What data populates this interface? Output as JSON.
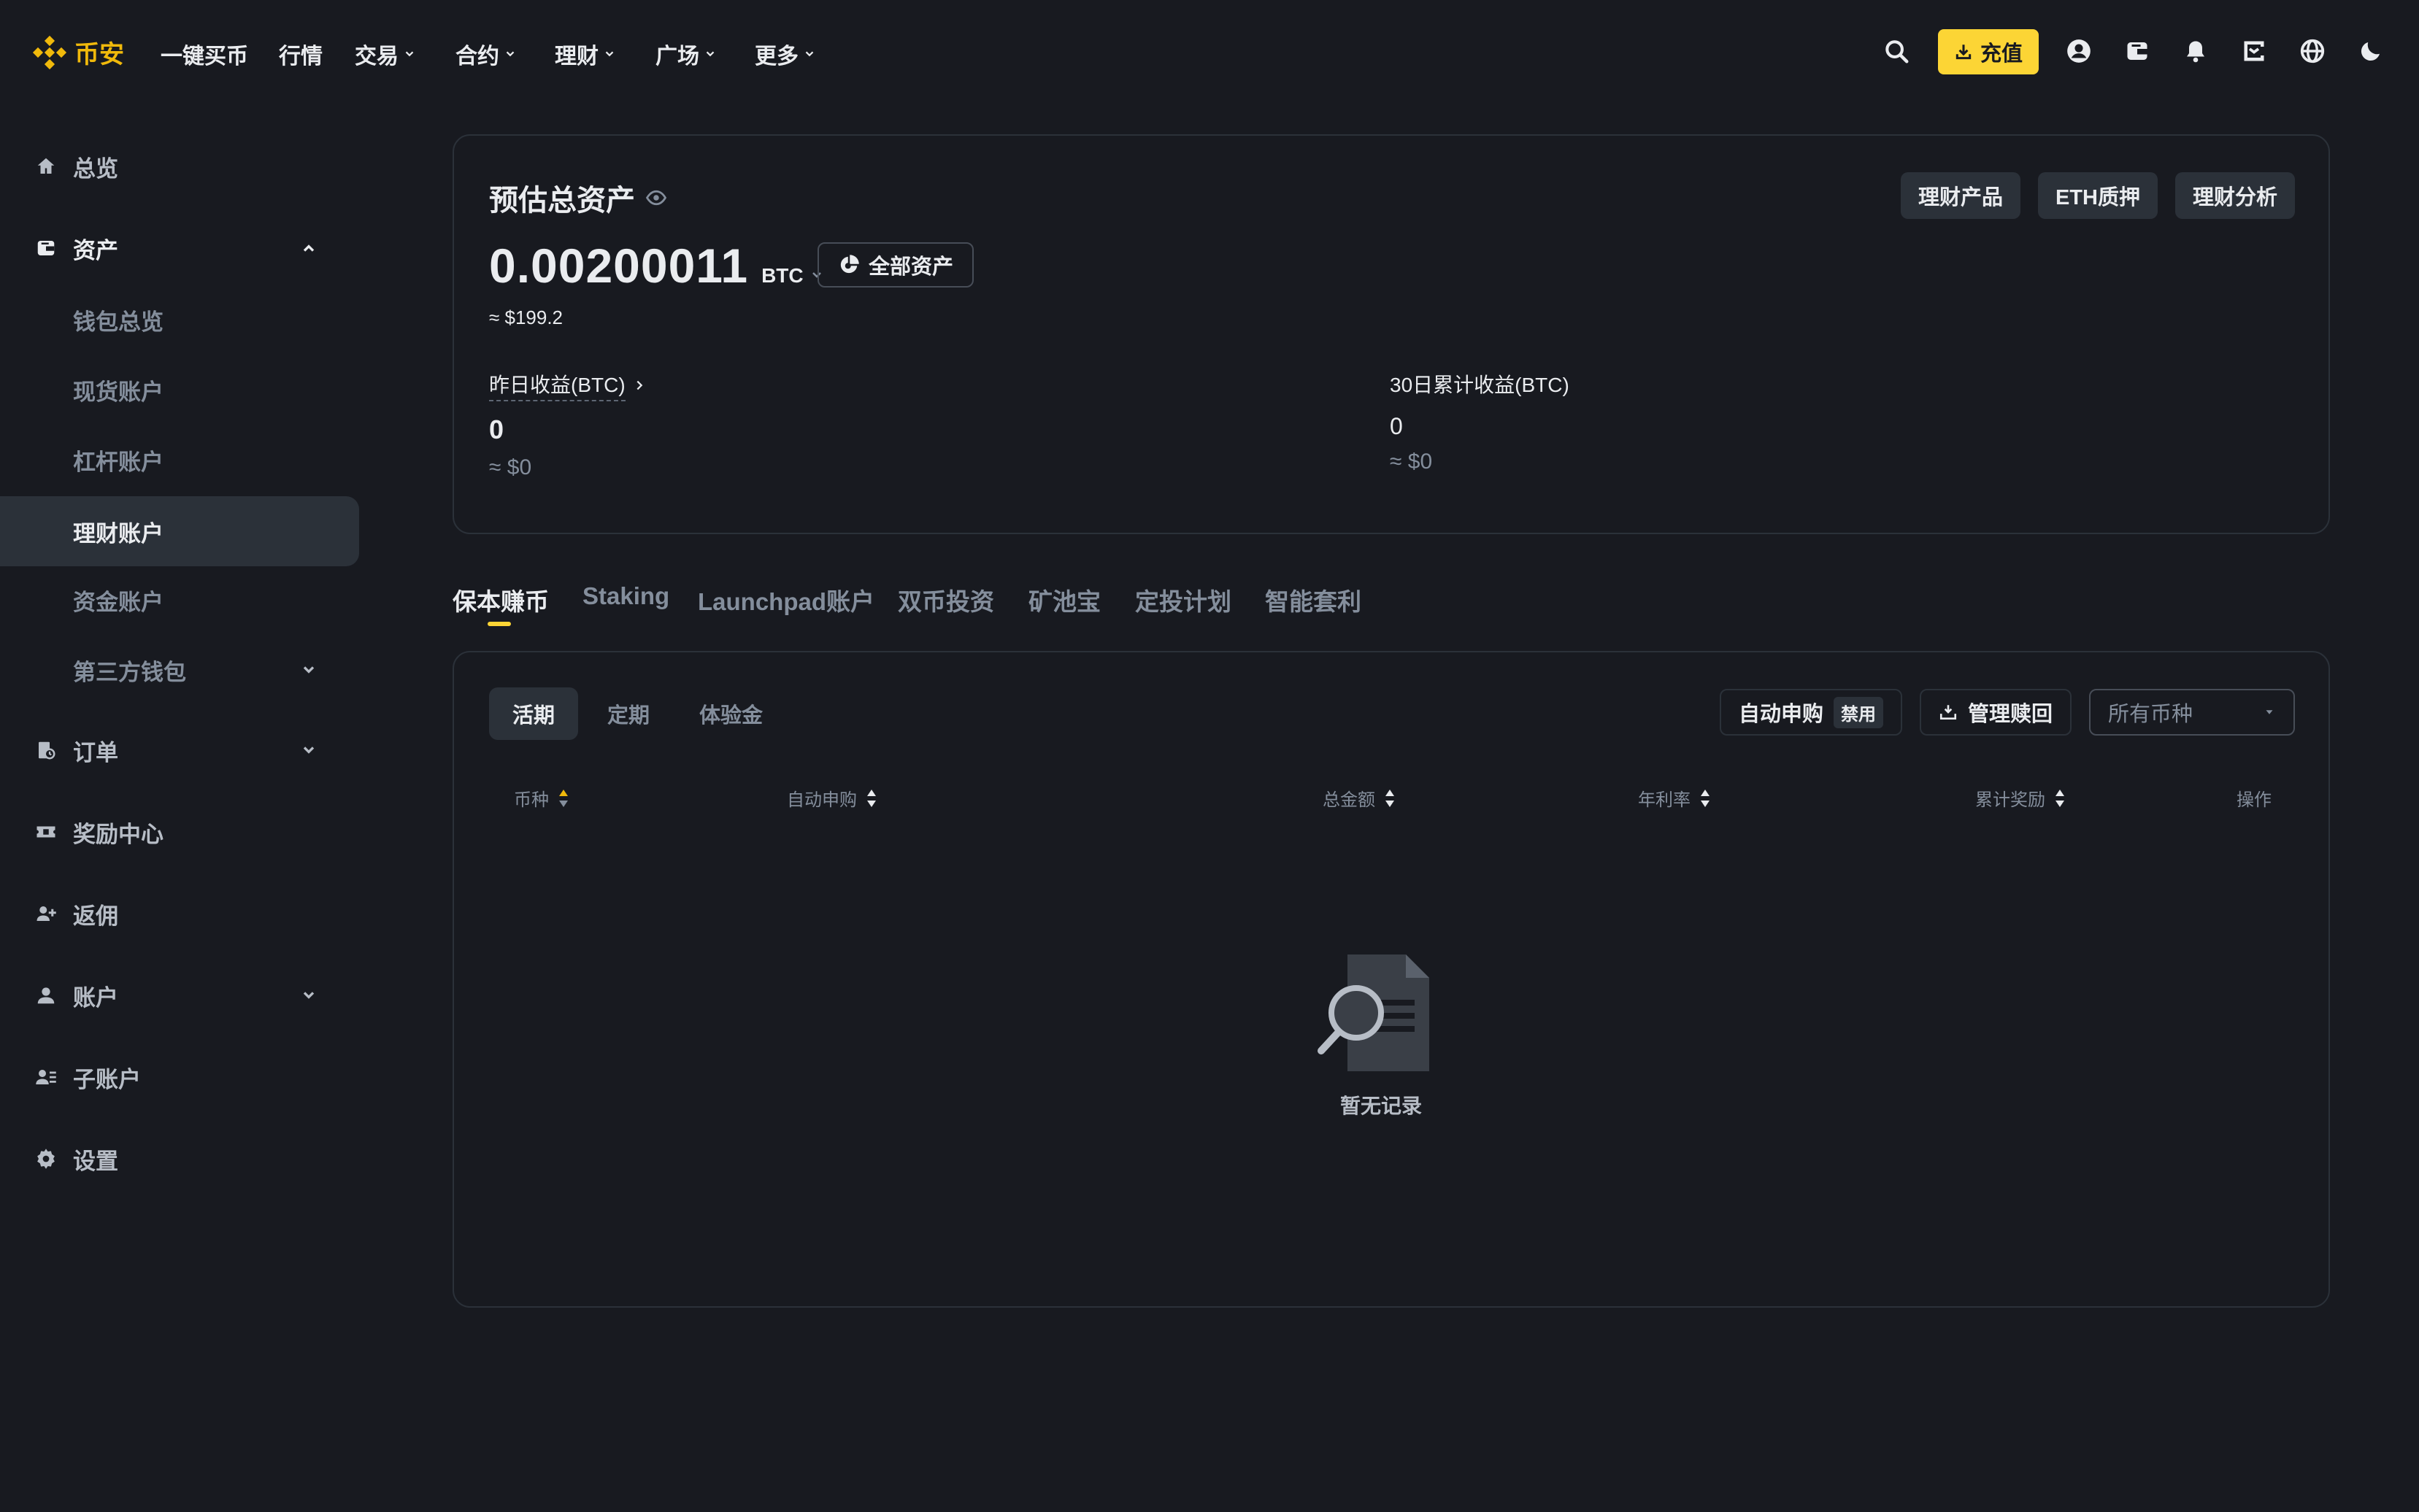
{
  "colors": {
    "background": "#181a20",
    "surface": "#2b3139",
    "accent": "#fcd535",
    "brand": "#f0b90b",
    "text": "#eaecef",
    "muted": "#848e9c"
  },
  "brand": {
    "name": "币安",
    "icon": "binance-logo-icon"
  },
  "nav": {
    "items": [
      "一键买币",
      "行情",
      "交易",
      "合约",
      "理财",
      "广场",
      "更多"
    ],
    "deposit_label": "充值",
    "icons": [
      "search-icon",
      "user-icon",
      "wallet-icon",
      "bell-icon",
      "download-icon",
      "globe-icon",
      "moon-icon"
    ]
  },
  "sidebar": {
    "overview": "总览",
    "assets": "资产",
    "wallet_overview": "钱包总览",
    "spot": "现货账户",
    "margin": "杠杆账户",
    "earn": "理财账户",
    "funding": "资金账户",
    "third_party": "第三方钱包",
    "orders": "订单",
    "rewards": "奖励中心",
    "referral": "返佣",
    "account": "账户",
    "sub_account": "子账户",
    "settings": "设置"
  },
  "asset": {
    "title": "预估总资产",
    "buttons": [
      "理财产品",
      "ETH质押",
      "理财分析"
    ],
    "balance": "0.00200011",
    "unit": "BTC",
    "all_assets": "全部资产",
    "approx_usd": "≈ $199.2",
    "yesterday_label": "昨日收益(BTC)",
    "yesterday_value": "0",
    "yesterday_usd": "≈ $0",
    "month_label": "30日累计收益(BTC)",
    "month_value": "0",
    "month_usd": "≈ $0"
  },
  "tabs": [
    "保本赚币",
    "Staking",
    "Launchpad账户",
    "双币投资",
    "矿池宝",
    "定投计划",
    "智能套利"
  ],
  "earn": {
    "subtabs": [
      "活期",
      "定期",
      "体验金"
    ],
    "auto_subscribe": "自动申购",
    "auto_status": "禁用",
    "manage_redeem": "管理赎回",
    "coin_filter": "所有币种",
    "columns": [
      "币种",
      "自动申购",
      "总金额",
      "年利率",
      "累计奖励",
      "操作"
    ],
    "empty": "暂无记录"
  }
}
